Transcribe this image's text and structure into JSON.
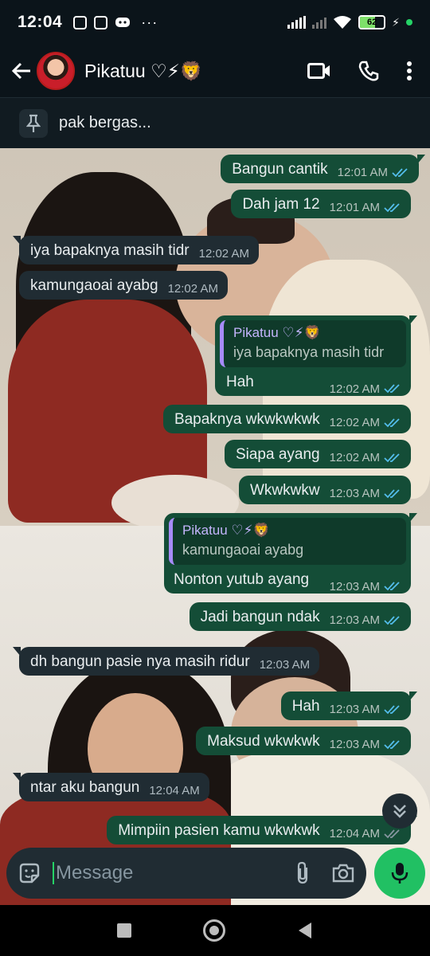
{
  "status_bar": {
    "time": "12:04",
    "battery_level": "62",
    "icons": [
      "instagram-icon",
      "instagram-icon",
      "discord-icon",
      "more-dots-icon"
    ],
    "more": "···"
  },
  "header": {
    "contact_name": "Pikatuu ♡⚡🦁",
    "icons": [
      "back-arrow-icon",
      "video-call-icon",
      "phone-icon",
      "overflow-menu-icon"
    ]
  },
  "pinned": {
    "text": "pak bergas..."
  },
  "messages": [
    {
      "dir": "out",
      "text": "Bangun cantik",
      "time": "12:01 AM"
    },
    {
      "dir": "out",
      "text": "Dah jam 12",
      "time": "12:01 AM"
    },
    {
      "dir": "in",
      "text": "iya bapaknya masih tidr",
      "time": "12:02 AM"
    },
    {
      "dir": "in",
      "text": "kamungaoai ayabg",
      "time": "12:02 AM"
    },
    {
      "dir": "out",
      "text": "Hah",
      "time": "12:02 AM",
      "quote_name": "Pikatuu ♡⚡🦁",
      "quote_text": "iya bapaknya masih tidr"
    },
    {
      "dir": "out",
      "text": "Bapaknya wkwkwkwk",
      "time": "12:02 AM"
    },
    {
      "dir": "out",
      "text": "Siapa ayang",
      "time": "12:02 AM"
    },
    {
      "dir": "out",
      "text": "Wkwkwkw",
      "time": "12:03 AM"
    },
    {
      "dir": "out",
      "text": "Nonton yutub ayang",
      "time": "12:03 AM",
      "quote_name": "Pikatuu ♡⚡🦁",
      "quote_text": "kamungaoai ayabg"
    },
    {
      "dir": "out",
      "text": "Jadi bangun ndak",
      "time": "12:03 AM"
    },
    {
      "dir": "in",
      "text": "dh bangun pasie nya masih ridur",
      "time": "12:03 AM"
    },
    {
      "dir": "out",
      "text": "Hah",
      "time": "12:03 AM"
    },
    {
      "dir": "out",
      "text": "Maksud wkwkwk",
      "time": "12:03 AM"
    },
    {
      "dir": "in",
      "text": "ntar aku bangun",
      "time": "12:04 AM"
    },
    {
      "dir": "out",
      "text": "Mimpiin pasien kamu wkwkwk",
      "time": "12:04 AM"
    }
  ],
  "composer": {
    "placeholder": "Message",
    "icons": [
      "sticker-icon",
      "attach-icon",
      "camera-icon",
      "mic-icon"
    ]
  },
  "colors": {
    "outgoing_bubble": "#144d37",
    "incoming_bubble": "#202c33",
    "accent_green": "#21c063",
    "read_ticks": "#53bdeb"
  }
}
